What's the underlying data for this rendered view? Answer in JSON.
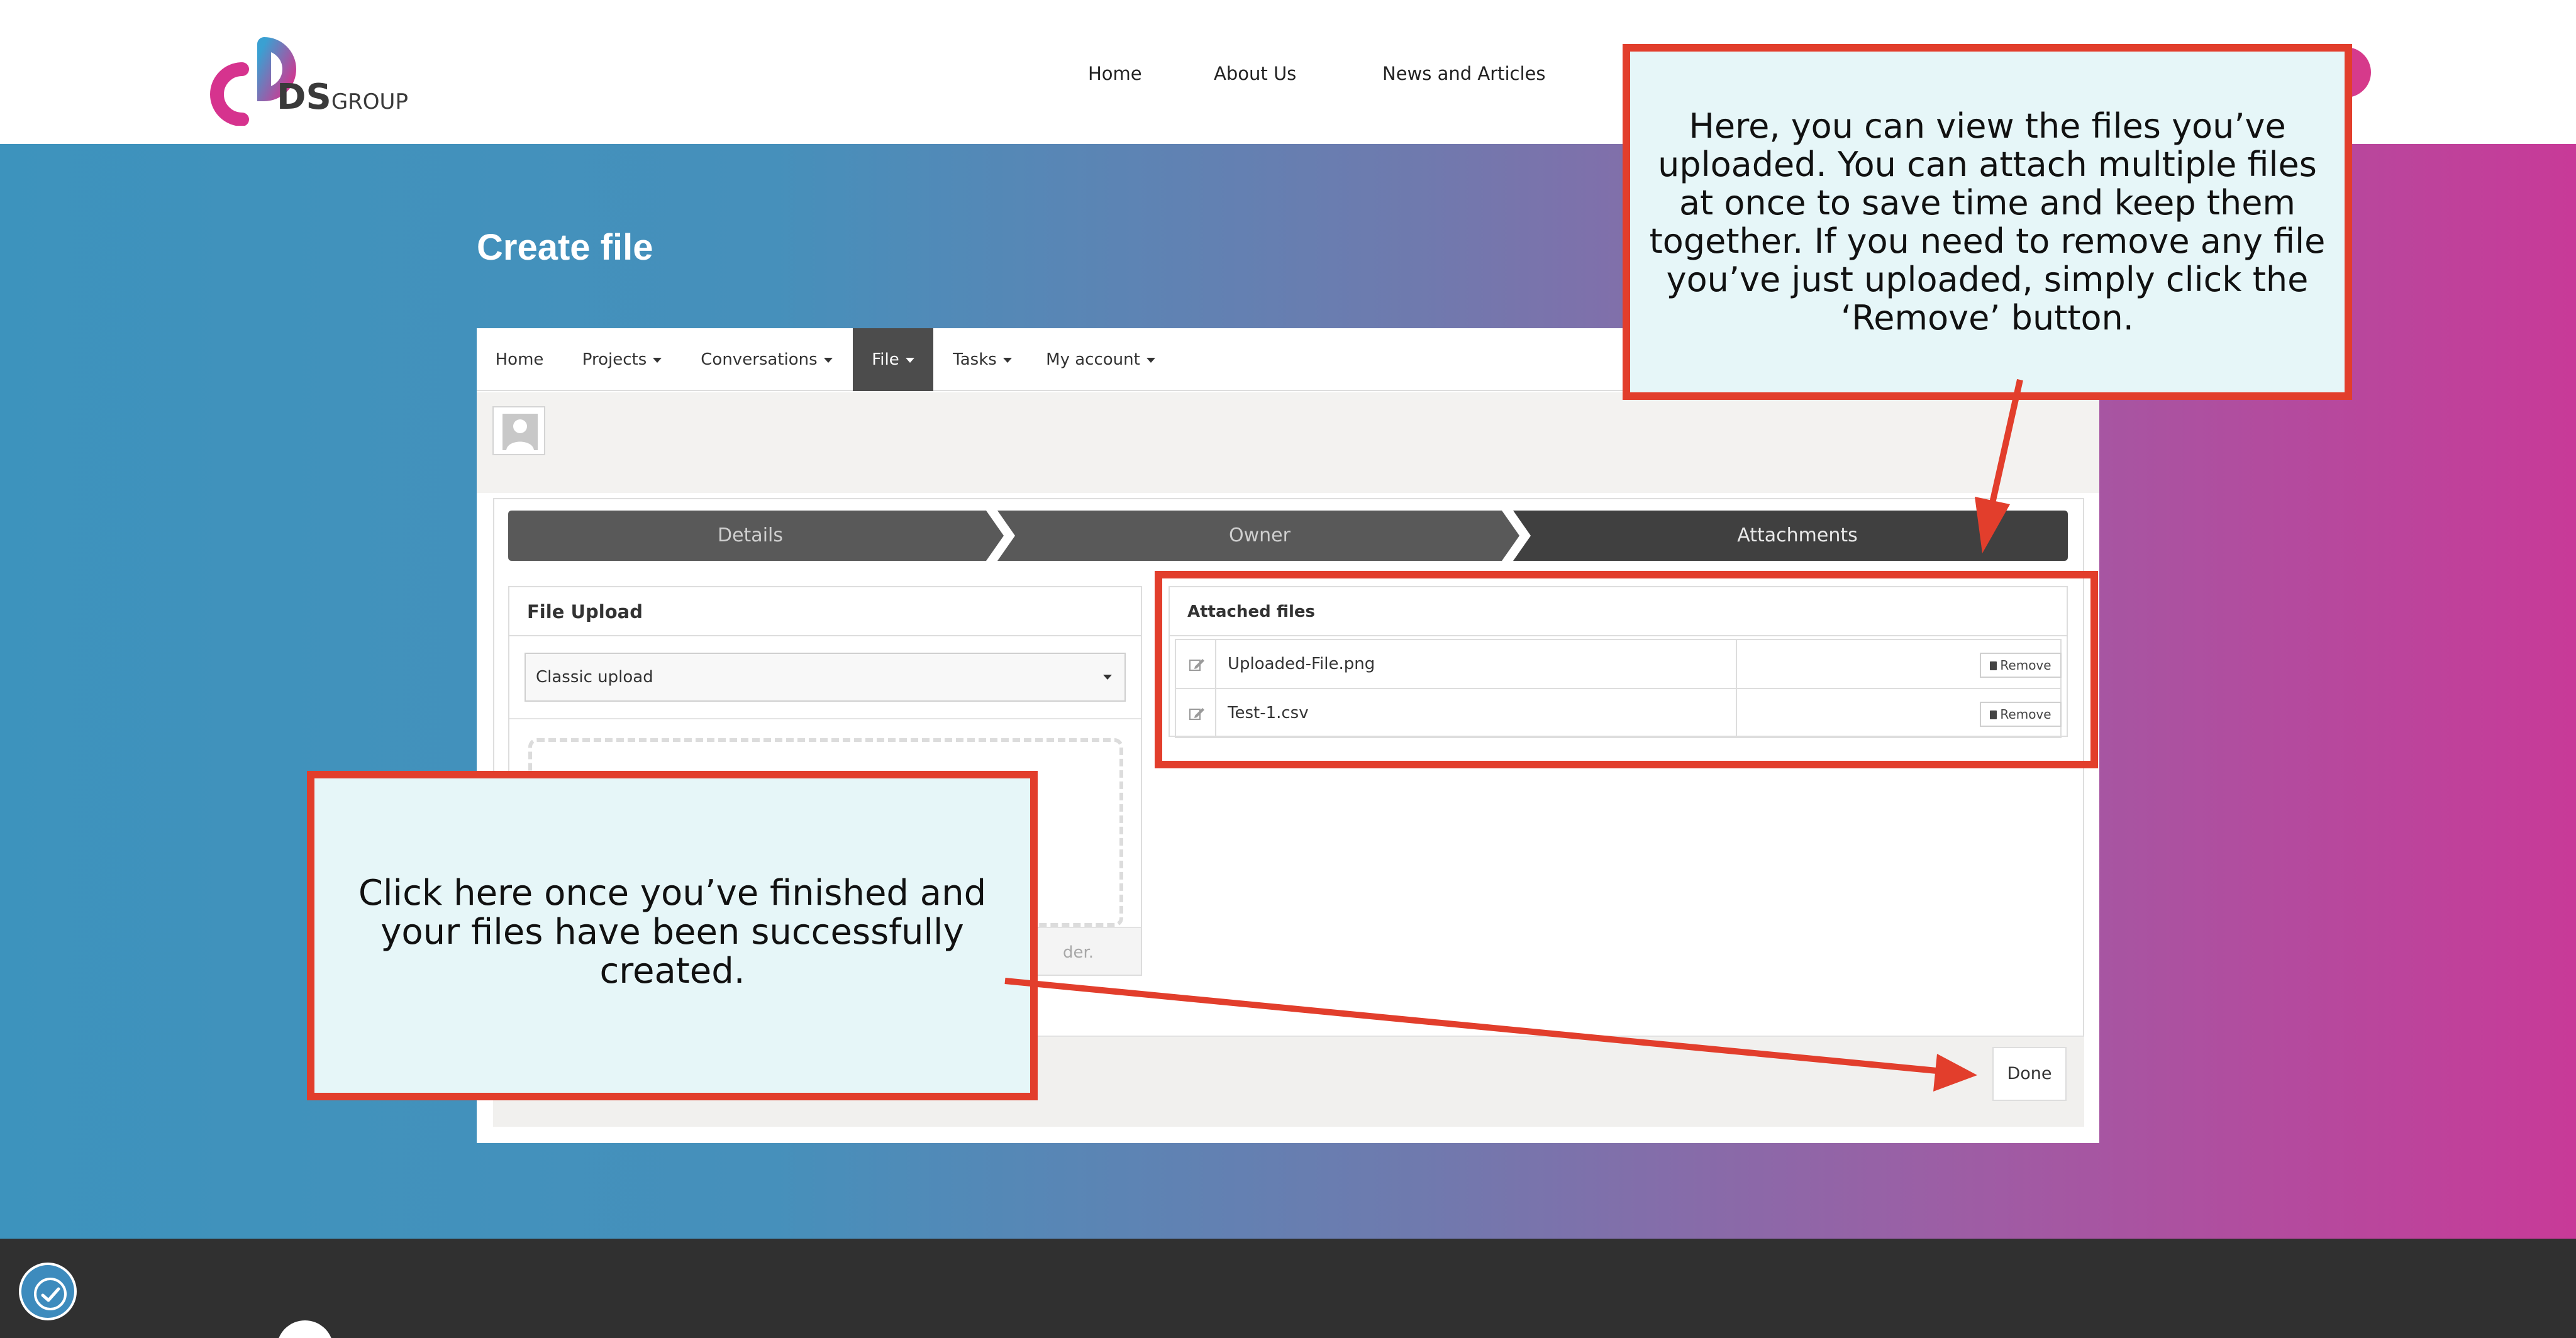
{
  "header": {
    "logo_text": "DS",
    "logo_subtext": "GROUP",
    "nav": [
      {
        "label": "Home"
      },
      {
        "label": "About Us"
      },
      {
        "label": "News and Articles"
      }
    ]
  },
  "page": {
    "title": "Create file"
  },
  "app_nav": {
    "tabs": [
      {
        "label": "Home",
        "dropdown": false,
        "active": false
      },
      {
        "label": "Projects",
        "dropdown": true,
        "active": false
      },
      {
        "label": "Conversations",
        "dropdown": true,
        "active": false
      },
      {
        "label": "File",
        "dropdown": true,
        "active": true
      },
      {
        "label": "Tasks",
        "dropdown": true,
        "active": false
      },
      {
        "label": "My account",
        "dropdown": true,
        "active": false
      }
    ]
  },
  "wizard": {
    "steps": [
      {
        "label": "Details",
        "active": false
      },
      {
        "label": "Owner",
        "active": false
      },
      {
        "label": "Attachments",
        "active": true
      }
    ]
  },
  "upload_panel": {
    "title": "File Upload",
    "select_value": "Classic upload",
    "footer_text_fragment": "der."
  },
  "attached_panel": {
    "title": "Attached files",
    "files": [
      {
        "name": "Uploaded-File.png",
        "action": "Remove"
      },
      {
        "name": "Test-1.csv",
        "action": "Remove"
      }
    ]
  },
  "actions": {
    "done_label": "Done"
  },
  "callouts": {
    "top": "Here, you can view the files you’ve uploaded. You can attach multiple files at once to save time and keep them together. If you need to remove any file you’ve just uploaded, simply click the ‘Remove’ button.",
    "bottom": "Click here once you’ve finished and your files have been successfully created."
  },
  "colors": {
    "callout_border": "#e23e2c",
    "callout_fill": "#e6f6f8",
    "gradient_start": "#3d93bd",
    "gradient_end": "#c83a98",
    "active_tab": "#4c4c4c",
    "step_inactive": "#595959",
    "step_active": "#404040"
  },
  "icons": {
    "avatar": "user-silhouette-icon",
    "edit": "edit-pencil-icon",
    "remove": "trash-icon",
    "accessibility": "accessibility-icon"
  }
}
